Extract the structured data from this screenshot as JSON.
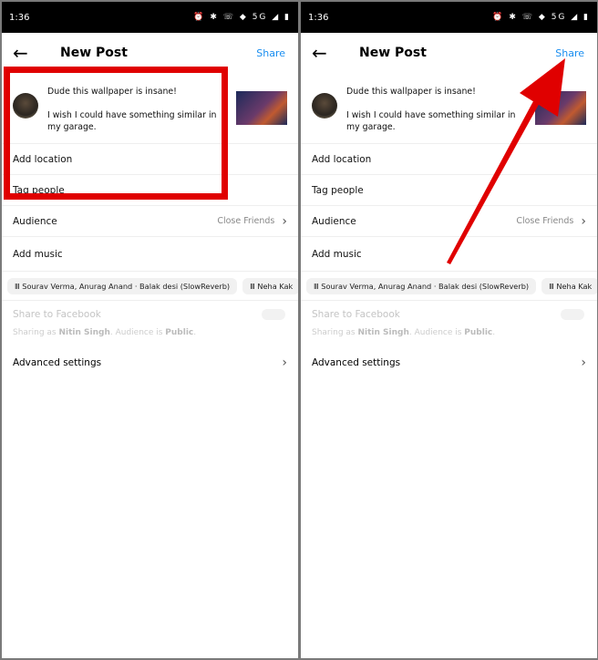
{
  "status": {
    "time": "1:36",
    "icons": "⏰ ✱ ☏ ◆ 5G ◢ ▮"
  },
  "header": {
    "back": "←",
    "title": "New Post",
    "share": "Share"
  },
  "post": {
    "line1": "Dude this wallpaper is insane!",
    "line2": "I wish I could have something similar in my garage."
  },
  "rows": {
    "location": "Add location",
    "tag": "Tag people",
    "audience": "Audience",
    "audience_value": "Close Friends",
    "music": "Add music",
    "chevron": "›"
  },
  "music_chips": [
    "Sourav Verma, Anurag Anand · Balak desi (SlowReverb)",
    "Neha Kak"
  ],
  "facebook": {
    "label": "Share to Facebook",
    "note_prefix": "Sharing as ",
    "name": "Nitin Singh",
    "note_mid": ". Audience is ",
    "audience": "Public",
    "note_end": "."
  },
  "advanced": "Advanced settings",
  "annotation": {
    "highlight_color": "#e00000",
    "arrow_color": "#e00000"
  }
}
